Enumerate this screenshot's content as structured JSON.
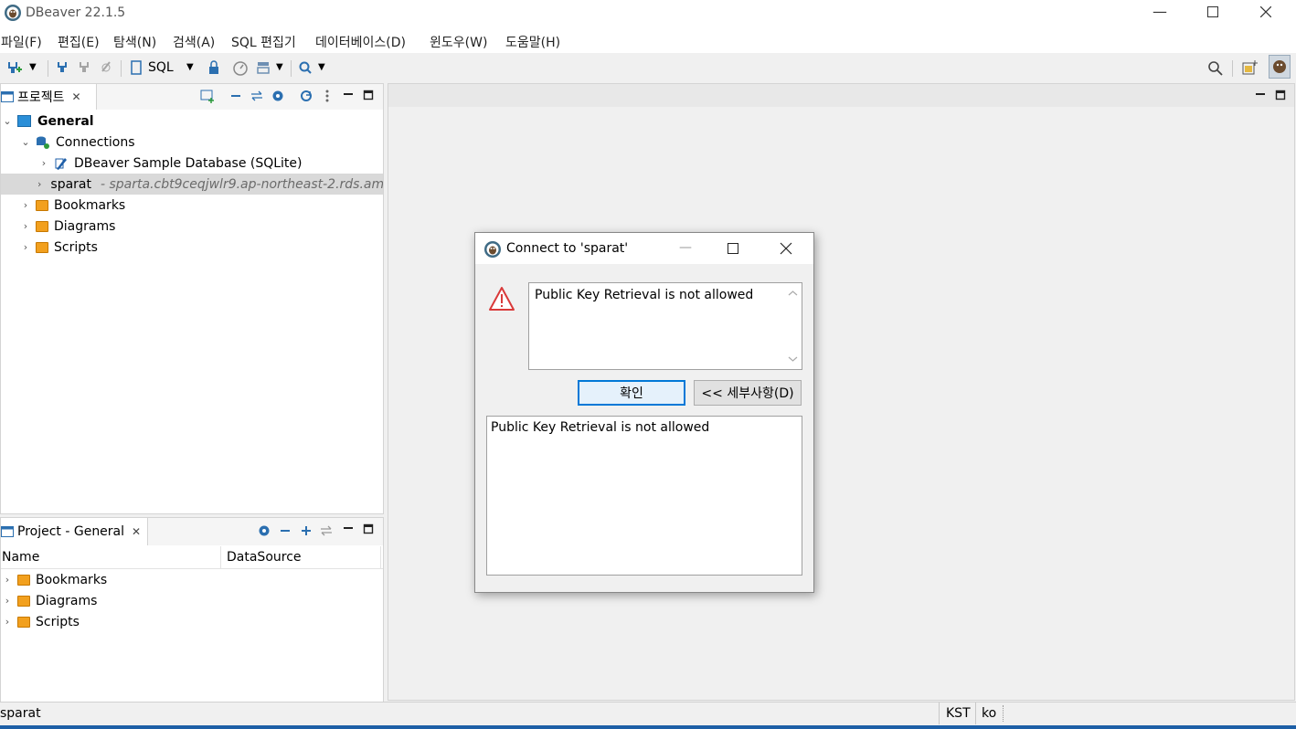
{
  "window": {
    "title": "DBeaver 22.1.5"
  },
  "menu": [
    "파일(F)",
    "편집(E)",
    "탐색(N)",
    "검색(A)",
    "SQL 편집기",
    "데이터베이스(D)",
    "윈도우(W)",
    "도움말(H)"
  ],
  "toolbar": {
    "sql_label": "SQL"
  },
  "project_panel": {
    "tab_label": "프로젝트",
    "tree": {
      "general": "General",
      "connections": "Connections",
      "sample_db": "DBeaver Sample Database (SQLite)",
      "sparat": "sparat",
      "sparat_host": "- sparta.cbt9ceqjwlr9.ap-northeast-2.rds.am",
      "bookmarks": "Bookmarks",
      "diagrams": "Diagrams",
      "scripts": "Scripts"
    }
  },
  "project_general_panel": {
    "tab_label": "Project - General",
    "columns": [
      "Name",
      "DataSource"
    ],
    "rows": [
      "Bookmarks",
      "Diagrams",
      "Scripts"
    ]
  },
  "dialog": {
    "title": "Connect to 'sparat'",
    "message": "Public Key Retrieval is not allowed",
    "ok_label": "확인",
    "details_label": "<< 세부사항(D)",
    "details_text": "Public Key Retrieval is not allowed"
  },
  "statusbar": {
    "left": "sparat",
    "timezone": "KST",
    "locale": "ko"
  }
}
